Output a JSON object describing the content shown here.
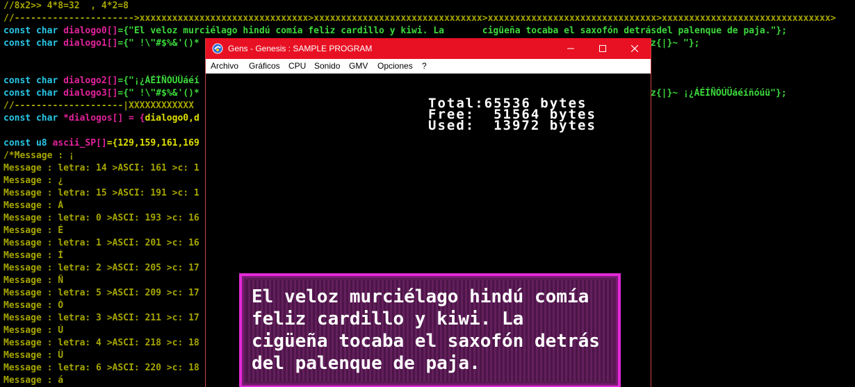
{
  "editor": {
    "l1": "//8x2>> 4*8=32  , 4*2=8",
    "l2": "//---------------------->xxxxxxxxxxxxxxxxxxxxxxxxxxxxxxx>xxxxxxxxxxxxxxxxxxxxxxxxxxxxxxx>xxxxxxxxxxxxxxxxxxxxxxxxxxxxxxx>xxxxxxxxxxxxxxxxxxxxxxxxxxxxxxx>",
    "l3_kw": "const char ",
    "l3_name": "dialogo0[]",
    "l3_str": "={\"El veloz murciélago hindú comía feliz cardillo y kiwi. La       cigüeña tocaba el saxofón detrásdel palenque de paja.\"};",
    "l4_kw": "const char ",
    "l4_name": "dialogo1[]",
    "l4_str": "={\" !\\\"#$%&'()*",
    "l4_tail": "z{|}~ \"};",
    "l6_kw": "const char ",
    "l6_name": "dialogo2[]",
    "l6_str": "={\"¡¿ÁÉÍÑÓÚÜáéí",
    "l7_kw": "const char ",
    "l7_name": "dialogo3[]",
    "l7_str": "={\" !\\\"#$%&'()*",
    "l7_tail": "z{|}~ ¡¿ÁÉÍÑÓÚÜáéíñóúü\"};",
    "l8": "//--------------------|XXXXXXXXXXXX",
    "l9_kw": "const char ",
    "l9_name": "*dialogos[] = {",
    "l9_str": "dialogo0,d",
    "l11_kw": "const u8 ",
    "l11_name": "ascii_SP[]",
    "l11_str": "={129,159,161,169",
    "msgs": [
      "/*Message : ¡",
      "Message : letra: 14 >ASCI: 161 >c: 1",
      "Message : ¿",
      "Message : letra: 15 >ASCI: 191 >c: 1",
      "Message : Á",
      "Message : letra: 0 >ASCI: 193 >c: 16",
      "Message : É",
      "Message : letra: 1 >ASCI: 201 >c: 16",
      "Message : Í",
      "Message : letra: 2 >ASCI: 205 >c: 17",
      "Message : Ñ",
      "Message : letra: 5 >ASCI: 209 >c: 17",
      "Message : Ó",
      "Message : letra: 3 >ASCI: 211 >c: 17",
      "Message : Ú",
      "Message : letra: 4 >ASCI: 218 >c: 18",
      "Message : Ü",
      "Message : letra: 6 >ASCI: 220 >c: 18",
      "Message : á"
    ]
  },
  "window": {
    "title": "Gens - Genesis : SAMPLE PROGRAM",
    "accent": "#e81123",
    "menu": [
      "Archivo",
      "Gráficos",
      "CPU",
      "Sonido",
      "GMV",
      "Opciones",
      "?"
    ]
  },
  "game": {
    "total": "Total:65536 bytes",
    "free": "Free:  51564 bytes",
    "used": "Used:  13972 bytes",
    "dialog": [
      "El veloz murciélago hindú comía",
      "feliz cardillo y kiwi. La",
      "cigüeña tocaba el saxofón detrás",
      "del palenque de paja."
    ],
    "dialog_border": "#e32ad8"
  }
}
